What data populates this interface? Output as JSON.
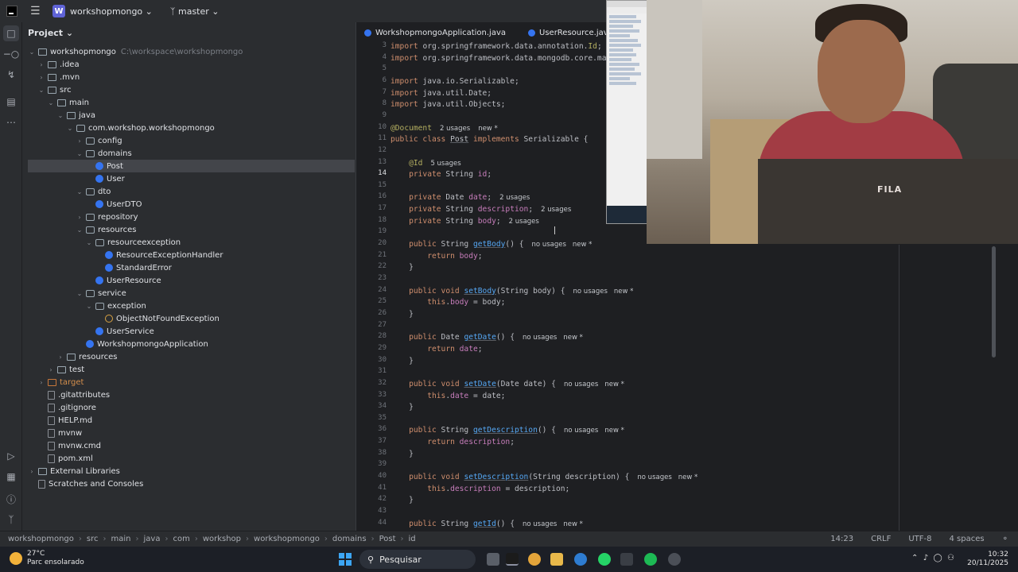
{
  "topbar": {
    "project_badge": "W",
    "project": "workshopmongo",
    "branch": "master"
  },
  "project_panel": {
    "title": "Project"
  },
  "tree": [
    {
      "label": "workshopmongo",
      "path": "C:\\workspace\\workshopmongo",
      "depth": 1,
      "arrow": "open",
      "icon": "folder"
    },
    {
      "label": ".idea",
      "depth": 2,
      "arrow": "closed",
      "icon": "folder"
    },
    {
      "label": ".mvn",
      "depth": 2,
      "arrow": "closed",
      "icon": "folder"
    },
    {
      "label": "src",
      "depth": 2,
      "arrow": "open",
      "icon": "folder"
    },
    {
      "label": "main",
      "depth": 3,
      "arrow": "open",
      "icon": "folder"
    },
    {
      "label": "java",
      "depth": 4,
      "arrow": "open",
      "icon": "folder"
    },
    {
      "label": "com.workshop.workshopmongo",
      "depth": 5,
      "arrow": "open",
      "icon": "pkg"
    },
    {
      "label": "config",
      "depth": 6,
      "arrow": "closed",
      "icon": "pkg"
    },
    {
      "label": "domains",
      "depth": 6,
      "arrow": "open",
      "icon": "pkg"
    },
    {
      "label": "Post",
      "depth": 7,
      "arrow": "",
      "icon": "java",
      "selected": true
    },
    {
      "label": "User",
      "depth": 7,
      "arrow": "",
      "icon": "java"
    },
    {
      "label": "dto",
      "depth": 6,
      "arrow": "open",
      "icon": "pkg"
    },
    {
      "label": "UserDTO",
      "depth": 7,
      "arrow": "",
      "icon": "java"
    },
    {
      "label": "repository",
      "depth": 6,
      "arrow": "closed",
      "icon": "pkg"
    },
    {
      "label": "resources",
      "depth": 6,
      "arrow": "open",
      "icon": "pkg"
    },
    {
      "label": "resourceexception",
      "depth": 7,
      "arrow": "open",
      "icon": "pkg"
    },
    {
      "label": "ResourceExceptionHandler",
      "depth": 8,
      "arrow": "",
      "icon": "java"
    },
    {
      "label": "StandardError",
      "depth": 8,
      "arrow": "",
      "icon": "java"
    },
    {
      "label": "UserResource",
      "depth": 7,
      "arrow": "",
      "icon": "java"
    },
    {
      "label": "service",
      "depth": 6,
      "arrow": "open",
      "icon": "pkg"
    },
    {
      "label": "exception",
      "depth": 7,
      "arrow": "open",
      "icon": "pkg"
    },
    {
      "label": "ObjectNotFoundException",
      "depth": 8,
      "arrow": "",
      "icon": "excl"
    },
    {
      "label": "UserService",
      "depth": 7,
      "arrow": "",
      "icon": "java"
    },
    {
      "label": "WorkshopmongoApplication",
      "depth": 6,
      "arrow": "",
      "icon": "java"
    },
    {
      "label": "resources",
      "depth": 4,
      "arrow": "closed",
      "icon": "folder"
    },
    {
      "label": "test",
      "depth": 3,
      "arrow": "closed",
      "icon": "folder"
    },
    {
      "label": "target",
      "depth": 2,
      "arrow": "closed",
      "icon": "orange",
      "orange": true
    },
    {
      "label": ".gitattributes",
      "depth": 2,
      "arrow": "",
      "icon": "file"
    },
    {
      "label": ".gitignore",
      "depth": 2,
      "arrow": "",
      "icon": "file"
    },
    {
      "label": "HELP.md",
      "depth": 2,
      "arrow": "",
      "icon": "file"
    },
    {
      "label": "mvnw",
      "depth": 2,
      "arrow": "",
      "icon": "file"
    },
    {
      "label": "mvnw.cmd",
      "depth": 2,
      "arrow": "",
      "icon": "file"
    },
    {
      "label": "pom.xml",
      "depth": 2,
      "arrow": "",
      "icon": "file"
    },
    {
      "label": "External Libraries",
      "depth": 1,
      "arrow": "closed",
      "icon": "folder"
    },
    {
      "label": "Scratches and Consoles",
      "depth": 1,
      "arrow": "",
      "icon": "file"
    }
  ],
  "tabs": [
    "WorkshopmongoApplication.java",
    "UserResource.java"
  ],
  "code": [
    {
      "n": "3",
      "html": "<span class='kw'>import</span> <span class='tx'>org.springframework.data.annotation.</span><span class='an'>Id</span><span class='tx'>;</span>"
    },
    {
      "n": "4",
      "html": "<span class='kw'>import</span> <span class='tx'>org.springframework.data.mongodb.core.mappin</span>"
    },
    {
      "n": "5",
      "html": ""
    },
    {
      "n": "6",
      "html": "<span class='kw'>import</span> <span class='tx'>java.io.Serializable;</span>"
    },
    {
      "n": "7",
      "html": "<span class='kw'>import</span> <span class='tx'>java.util.Date;</span>"
    },
    {
      "n": "8",
      "html": "<span class='kw'>import</span> <span class='tx'>java.util.Objects;</span>"
    },
    {
      "n": "9",
      "html": ""
    },
    {
      "n": "10",
      "html": "<span class='an'>@Document</span><span class='hint'>2 usages</span><span class='hint'>new *</span>"
    },
    {
      "n": "11",
      "html": "<span class='kw'>public class</span> <span class='tx under'>Post</span> <span class='kw'>implements</span> <span class='tx'>Serializable {</span>"
    },
    {
      "n": "12",
      "html": ""
    },
    {
      "n": "13",
      "html": "    <span class='an'>@Id</span><span class='hint'>5 usages</span>"
    },
    {
      "n": "14",
      "html": "    <span class='kw'>private</span> <span class='tx'>String</span> <span class='fld'>id</span><span class='tx'>;</span>",
      "cur": true
    },
    {
      "n": "15",
      "html": ""
    },
    {
      "n": "16",
      "html": "    <span class='kw'>private</span> <span class='tx'>Date</span> <span class='fld'>date</span><span class='tx'>;</span><span class='hint'>2 usages</span>"
    },
    {
      "n": "17",
      "html": "    <span class='kw'>private</span> <span class='tx'>String</span> <span class='fld'>description</span><span class='tx'>;</span><span class='hint'>2 usages</span>"
    },
    {
      "n": "18",
      "html": "    <span class='kw'>private</span> <span class='tx'>String</span> <span class='fld'>body</span><span class='tx'>;</span><span class='hint'>2 usages</span>"
    },
    {
      "n": "19",
      "html": ""
    },
    {
      "n": "20",
      "html": "    <span class='kw'>public</span> <span class='tx'>String</span> <span class='fn under'>getBody</span><span class='tx'>() {</span><span class='hint'>no usages</span><span class='hint2'>new *</span>"
    },
    {
      "n": "21",
      "html": "        <span class='kw'>return</span> <span class='fld'>body</span><span class='tx'>;</span>"
    },
    {
      "n": "22",
      "html": "    <span class='tx'>}</span>"
    },
    {
      "n": "23",
      "html": ""
    },
    {
      "n": "24",
      "html": "    <span class='kw'>public void</span> <span class='fn under'>setBody</span><span class='tx'>(String body) {</span><span class='hint'>no usages</span><span class='hint2'>new *</span>"
    },
    {
      "n": "25",
      "html": "        <span class='kw'>this</span><span class='tx'>.</span><span class='fld'>body</span> <span class='tx'>= body;</span>"
    },
    {
      "n": "26",
      "html": "    <span class='tx'>}</span>"
    },
    {
      "n": "27",
      "html": ""
    },
    {
      "n": "28",
      "html": "    <span class='kw'>public</span> <span class='tx'>Date</span> <span class='fn under'>getDate</span><span class='tx'>() {</span><span class='hint'>no usages</span><span class='hint2'>new *</span>"
    },
    {
      "n": "29",
      "html": "        <span class='kw'>return</span> <span class='fld'>date</span><span class='tx'>;</span>"
    },
    {
      "n": "30",
      "html": "    <span class='tx'>}</span>"
    },
    {
      "n": "31",
      "html": ""
    },
    {
      "n": "32",
      "html": "    <span class='kw'>public void</span> <span class='fn under'>setDate</span><span class='tx'>(Date date) {</span><span class='hint'>no usages</span><span class='hint2'>new *</span>"
    },
    {
      "n": "33",
      "html": "        <span class='kw'>this</span><span class='tx'>.</span><span class='fld'>date</span> <span class='tx'>= date;</span>"
    },
    {
      "n": "34",
      "html": "    <span class='tx'>}</span>"
    },
    {
      "n": "35",
      "html": ""
    },
    {
      "n": "36",
      "html": "    <span class='kw'>public</span> <span class='tx'>String</span> <span class='fn under'>getDescription</span><span class='tx'>() {</span><span class='hint'>no usages</span><span class='hint2'>new *</span>"
    },
    {
      "n": "37",
      "html": "        <span class='kw'>return</span> <span class='fld'>description</span><span class='tx'>;</span>"
    },
    {
      "n": "38",
      "html": "    <span class='tx'>}</span>"
    },
    {
      "n": "39",
      "html": ""
    },
    {
      "n": "40",
      "html": "    <span class='kw'>public void</span> <span class='fn under'>setDescription</span><span class='tx'>(String description) {</span><span class='hint'>no usages</span><span class='hint2'>new *</span>"
    },
    {
      "n": "41",
      "html": "        <span class='kw'>this</span><span class='tx'>.</span><span class='fld'>description</span> <span class='tx'>= description;</span>"
    },
    {
      "n": "42",
      "html": "    <span class='tx'>}</span>"
    },
    {
      "n": "43",
      "html": ""
    },
    {
      "n": "44",
      "html": "    <span class='kw'>public</span> <span class='tx'>String</span> <span class='fn under'>getId</span><span class='tx'>() {</span><span class='hint'>no usages</span><span class='hint2'>new *</span>"
    }
  ],
  "statusbar": {
    "crumbs": [
      "workshopmongo",
      "src",
      "main",
      "java",
      "com",
      "workshop",
      "workshopmongo",
      "domains",
      "Post",
      "id"
    ],
    "position": "14:23",
    "line_sep": "CRLF",
    "encoding": "UTF-8",
    "indent": "4 spaces"
  },
  "taskbar": {
    "temp": "27°C",
    "weather": "Parc ensolarado",
    "search": "Pesquisar",
    "time": "10:32",
    "date": "20/11/2025"
  },
  "webcam": {
    "shirt_logo": "FILA"
  }
}
